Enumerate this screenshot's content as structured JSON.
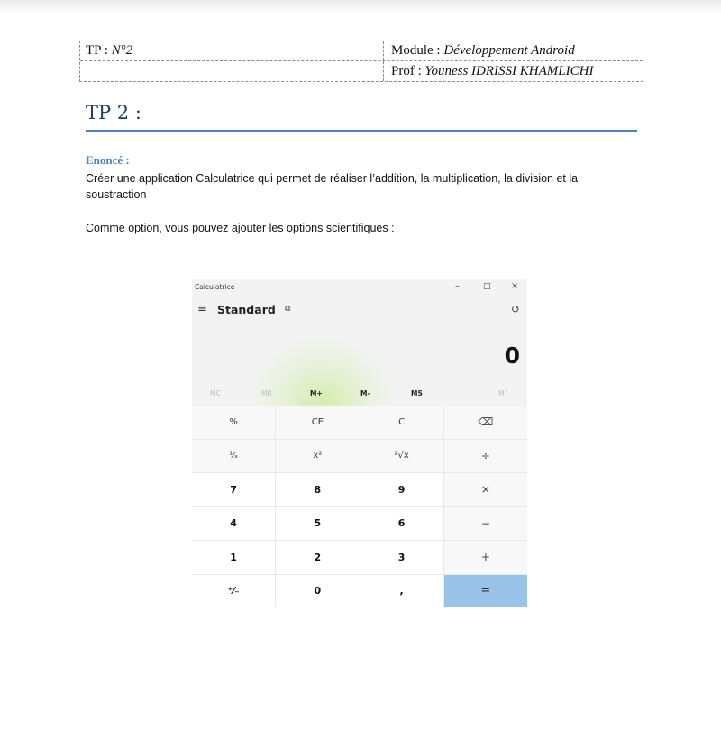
{
  "header": {
    "tp_label": "TP : ",
    "tp_value": "N°2",
    "module_label": "Module : ",
    "module_value": "Développement Android",
    "prof_label": "Prof : ",
    "prof_value": "Youness IDRISSI KHAMLICHI"
  },
  "title": "TP 2 :",
  "enonce_label": "Enoncé :",
  "paragraph1": "Créer une application Calculatrice qui permet de réaliser l’addition, la multiplication, la division et la soustraction",
  "paragraph2": "Comme option, vous pouvez ajouter les options scientifiques :",
  "calculator": {
    "app_title": "Calculatrice",
    "window_buttons": [
      "–",
      "□",
      "×"
    ],
    "mode": "Standard",
    "hamburger_icon": "≡",
    "keep_on_top_icon": "⧉",
    "history_icon": "↺",
    "display": "0",
    "memory": [
      "MC",
      "MR",
      "M+",
      "M-",
      "MS",
      "M˅"
    ],
    "keys": [
      [
        "%",
        "CE",
        "C",
        "⌫"
      ],
      [
        "¹⁄ₓ",
        "x²",
        "²√x",
        "÷"
      ],
      [
        "7",
        "8",
        "9",
        "×"
      ],
      [
        "4",
        "5",
        "6",
        "−"
      ],
      [
        "1",
        "2",
        "3",
        "+"
      ],
      [
        "⁺⁄₋",
        "0",
        ",",
        "="
      ]
    ]
  }
}
